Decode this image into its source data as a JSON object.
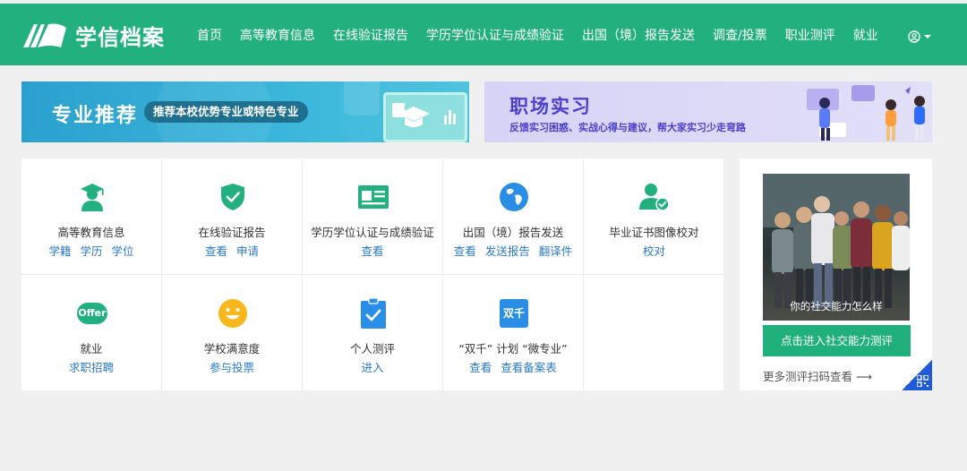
{
  "header": {
    "logo_text": "学信档案",
    "nav": [
      "首页",
      "高等教育信息",
      "在线验证报告",
      "学历学位认证与成绩验证",
      "出国（境）报告发送",
      "调查/投票",
      "职业测评",
      "就业"
    ],
    "user_icon": "user-circle-icon",
    "colors": {
      "brand": "#23b07f",
      "link": "#2b78c5"
    }
  },
  "banners": {
    "left": {
      "title": "专业推荐",
      "subtitle": "推荐本校优势专业或特色专业"
    },
    "right": {
      "title": "职场实习",
      "subtitle": "反馈实习困惑、实战心得与建议，帮大家实习少走弯路"
    }
  },
  "services": [
    {
      "title": "高等教育信息",
      "icon": "graduate-icon",
      "links": [
        "学籍",
        "学历",
        "学位"
      ]
    },
    {
      "title": "在线验证报告",
      "icon": "shield-check-icon",
      "links": [
        "查看",
        "申请"
      ]
    },
    {
      "title": "学历学位认证与成绩验证",
      "icon": "id-card-icon",
      "links": [
        "查看"
      ]
    },
    {
      "title": "出国（境）报告发送",
      "icon": "globe-icon",
      "links": [
        "查看",
        "发送报告",
        "翻译件"
      ]
    },
    {
      "title": "毕业证书图像校对",
      "icon": "user-check-icon",
      "links": [
        "校对"
      ]
    },
    {
      "title": "就业",
      "icon": "offer-icon",
      "icon_text": "Offer",
      "links": [
        "求职招聘"
      ]
    },
    {
      "title": "学校满意度",
      "icon": "smiley-icon",
      "links": [
        "参与投票"
      ]
    },
    {
      "title": "个人测评",
      "icon": "clipboard-check-icon",
      "links": [
        "进入"
      ]
    },
    {
      "title": "“双千” 计划 “微专业”",
      "icon": "shuangqian-icon",
      "icon_text": "双千",
      "links": [
        "查看",
        "查看备案表"
      ]
    }
  ],
  "side_card": {
    "photo_caption": "你的社交能力怎么样",
    "cta": "点击进入社交能力测评",
    "more": "更多测评扫码查看 ⟶"
  }
}
